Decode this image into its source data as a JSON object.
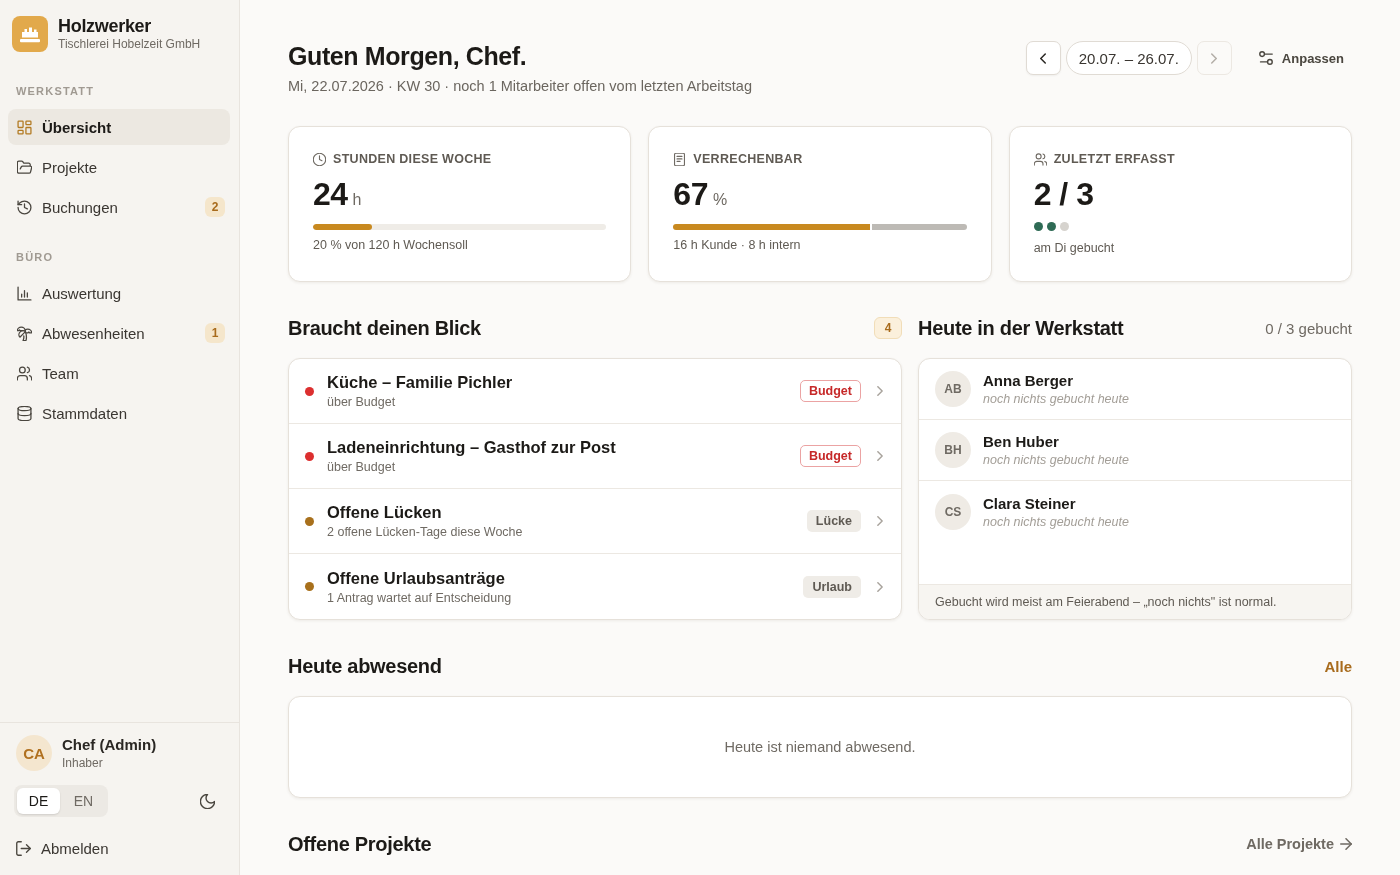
{
  "brand": {
    "name": "Holzwerker",
    "company": "Tischlerei Hobelzeit GmbH"
  },
  "nav_sections": [
    {
      "heading": "WERKSTATT",
      "items": [
        {
          "label": "Übersicht",
          "selected": true
        },
        {
          "label": "Projekte",
          "selected": false
        },
        {
          "label": "Buchungen",
          "selected": false,
          "badge": "2"
        }
      ]
    },
    {
      "heading": "BÜRO",
      "items": [
        {
          "label": "Auswertung",
          "selected": false
        },
        {
          "label": "Abwesenheiten",
          "selected": false,
          "badge": "1"
        },
        {
          "label": "Team",
          "selected": false
        },
        {
          "label": "Stammdaten",
          "selected": false
        }
      ]
    }
  ],
  "user": {
    "initials": "CA",
    "name": "Chef (Admin)",
    "role": "Inhaber"
  },
  "languages": [
    {
      "label": "DE",
      "selected": true
    },
    {
      "label": "EN",
      "selected": false
    }
  ],
  "logout": {
    "label": "Abmelden"
  },
  "header": {
    "title": "Guten Morgen, Chef.",
    "subtitle": "Mi, 22.07.2026 · KW 30 · noch 1 Mitarbeiter offen vom letzten Arbeitstag"
  },
  "date_nav": {
    "range": "20.07. – 26.07.",
    "prev": {
      "disabled": false
    },
    "next": {
      "disabled": true
    }
  },
  "customize": {
    "label": "Anpassen"
  },
  "stats": [
    {
      "kind": "progress",
      "label": "STUNDEN DIESE WOCHE",
      "value": "24",
      "unit": "h",
      "level": 0.2,
      "caption": "20 % von 120 h Wochensoll"
    },
    {
      "kind": "split",
      "label": "VERRECHENBAR",
      "value": "67",
      "unit": "%",
      "level": 0.67,
      "caption": "16 h Kunde · 8 h intern"
    },
    {
      "kind": "dots",
      "label": "ZULETZT ERFASST",
      "value": "2 / 3",
      "dots": [
        {
          "booked": true
        },
        {
          "booked": true
        },
        {
          "booked": false
        }
      ],
      "caption": "am Di gebucht"
    }
  ],
  "attention": {
    "title": "Braucht deinen Blick",
    "count": "4",
    "items": [
      {
        "kind": "alert",
        "title": "Küche – Familie Pichler",
        "subtitle": "über Budget",
        "tag": "Budget",
        "color": "#dc2f2f"
      },
      {
        "kind": "alert",
        "title": "Ladeneinrichtung – Gasthof zur Post",
        "subtitle": "über Budget",
        "tag": "Budget",
        "color": "#dc2f2f"
      },
      {
        "kind": "neutral",
        "title": "Offene Lücken",
        "subtitle": "2 offene Lücken-Tage diese Woche",
        "tag": "Lücke",
        "color": "#a8701c"
      },
      {
        "kind": "neutral",
        "title": "Offene Urlaubsanträge",
        "subtitle": "1 Antrag wartet auf Entscheidung",
        "tag": "Urlaub",
        "color": "#a8701c"
      }
    ]
  },
  "workshop": {
    "title": "Heute in der Werkstatt",
    "summary": "0 / 3 gebucht",
    "people": [
      {
        "initials": "AB",
        "name": "Anna Berger",
        "status": "noch nichts gebucht heute"
      },
      {
        "initials": "BH",
        "name": "Ben Huber",
        "status": "noch nichts gebucht heute"
      },
      {
        "initials": "CS",
        "name": "Clara Steiner",
        "status": "noch nichts gebucht heute"
      }
    ],
    "note": "Gebucht wird meist am Feierabend – „noch nichts\" ist normal."
  },
  "absent": {
    "title": "Heute abwesend",
    "link": "Alle",
    "empty_text": "Heute ist niemand abwesend."
  },
  "projects": {
    "title": "Offene Projekte",
    "link": "Alle Projekte"
  }
}
